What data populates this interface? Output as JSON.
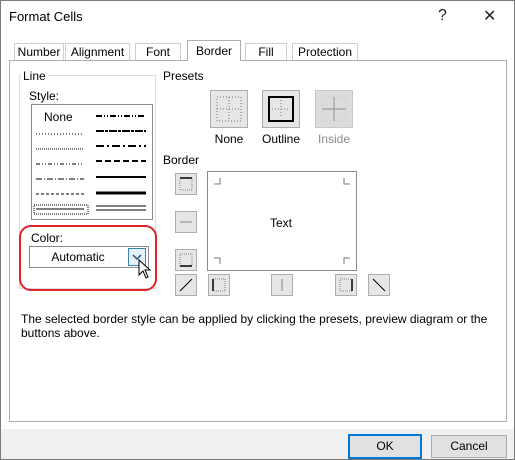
{
  "window": {
    "title": "Format Cells",
    "help": "?",
    "close": "✕"
  },
  "tabs": [
    {
      "label": "Number"
    },
    {
      "label": "Alignment"
    },
    {
      "label": "Font"
    },
    {
      "label": "Border"
    },
    {
      "label": "Fill"
    },
    {
      "label": "Protection"
    }
  ],
  "line": {
    "group_label": "Line",
    "style_label": "Style:",
    "none_label": "None",
    "color_label": "Color:",
    "color_value": "Automatic"
  },
  "presets": {
    "group_label": "Presets",
    "items": [
      {
        "label": "None"
      },
      {
        "label": "Outline"
      },
      {
        "label": "Inside"
      }
    ]
  },
  "border": {
    "group_label": "Border",
    "preview_text": "Text"
  },
  "description": "The selected border style can be applied by clicking the presets, preview diagram or the buttons above.",
  "buttons": {
    "ok": "OK",
    "cancel": "Cancel"
  },
  "colors": {
    "highlight": "#e0232a",
    "accent": "#0078d7"
  }
}
